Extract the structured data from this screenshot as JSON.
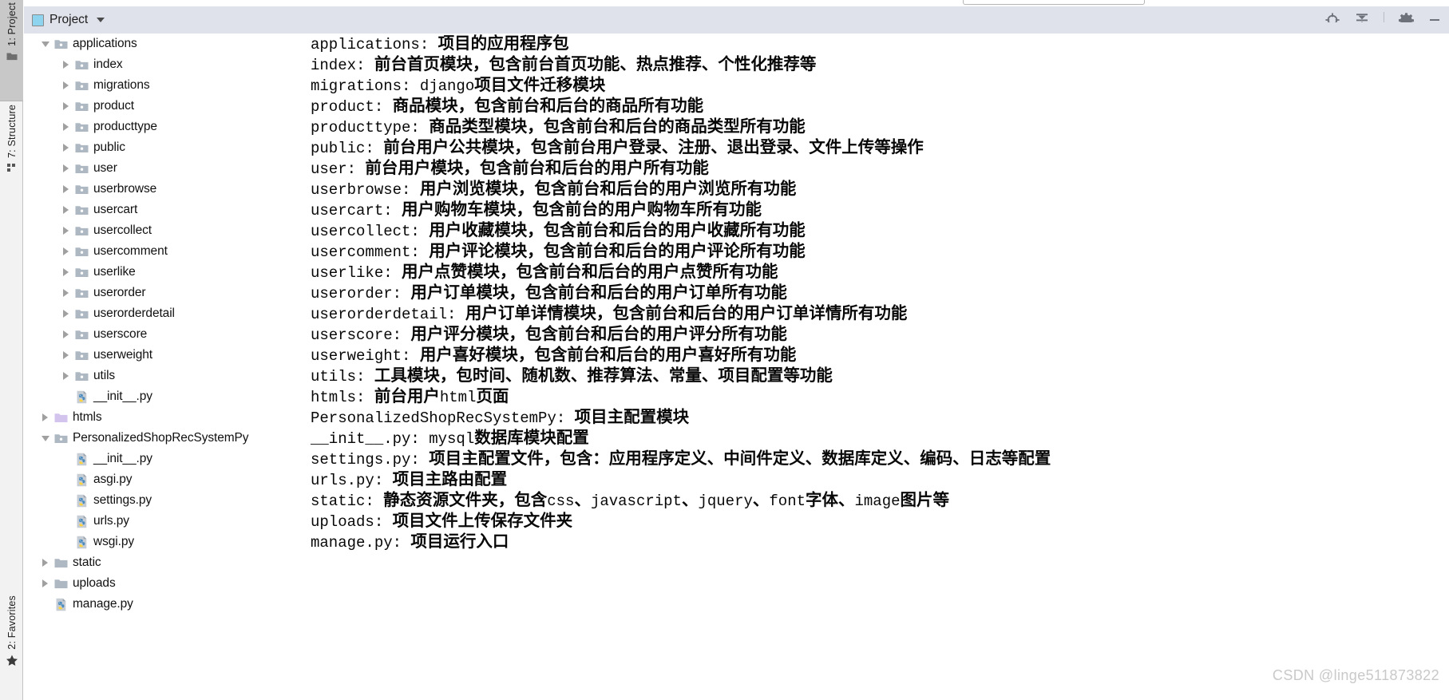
{
  "window": {
    "panel_title": "Project",
    "watermark": "CSDN @linge511873822"
  },
  "left_strip": {
    "tabs": [
      {
        "label": "1: Project",
        "icon": "project-folder-icon",
        "active": true
      },
      {
        "label": "7: Structure",
        "icon": "structure-blocks-icon",
        "active": false
      },
      {
        "label": "2: Favorites",
        "icon": "star-icon",
        "active": false
      }
    ]
  },
  "header_actions": [
    {
      "name": "locate-target-icon",
      "label": "Select Opened File"
    },
    {
      "name": "collapse-all-icon",
      "label": "Collapse All"
    },
    {
      "name": "gear-icon",
      "label": "Settings"
    },
    {
      "name": "hide-icon",
      "label": "Hide"
    }
  ],
  "tree": {
    "items": [
      {
        "label": "applications",
        "icon": "folder-module-icon",
        "arrow": "down",
        "indent": 1
      },
      {
        "label": "index",
        "icon": "folder-module-icon",
        "arrow": "right",
        "indent": 2
      },
      {
        "label": "migrations",
        "icon": "folder-module-icon",
        "arrow": "right",
        "indent": 2
      },
      {
        "label": "product",
        "icon": "folder-module-icon",
        "arrow": "right",
        "indent": 2
      },
      {
        "label": "producttype",
        "icon": "folder-module-icon",
        "arrow": "right",
        "indent": 2
      },
      {
        "label": "public",
        "icon": "folder-module-icon",
        "arrow": "right",
        "indent": 2
      },
      {
        "label": "user",
        "icon": "folder-module-icon",
        "arrow": "right",
        "indent": 2
      },
      {
        "label": "userbrowse",
        "icon": "folder-module-icon",
        "arrow": "right",
        "indent": 2
      },
      {
        "label": "usercart",
        "icon": "folder-module-icon",
        "arrow": "right",
        "indent": 2
      },
      {
        "label": "usercollect",
        "icon": "folder-module-icon",
        "arrow": "right",
        "indent": 2
      },
      {
        "label": "usercomment",
        "icon": "folder-module-icon",
        "arrow": "right",
        "indent": 2
      },
      {
        "label": "userlike",
        "icon": "folder-module-icon",
        "arrow": "right",
        "indent": 2
      },
      {
        "label": "userorder",
        "icon": "folder-module-icon",
        "arrow": "right",
        "indent": 2
      },
      {
        "label": "userorderdetail",
        "icon": "folder-module-icon",
        "arrow": "right",
        "indent": 2
      },
      {
        "label": "userscore",
        "icon": "folder-module-icon",
        "arrow": "right",
        "indent": 2
      },
      {
        "label": "userweight",
        "icon": "folder-module-icon",
        "arrow": "right",
        "indent": 2
      },
      {
        "label": "utils",
        "icon": "folder-module-icon",
        "arrow": "right",
        "indent": 2
      },
      {
        "label": "__init__.py",
        "icon": "python-file-icon",
        "arrow": "none",
        "indent": 2
      },
      {
        "label": "htmls",
        "icon": "folder-template-icon",
        "arrow": "right",
        "indent": 1
      },
      {
        "label": "PersonalizedShopRecSystemPy",
        "icon": "folder-module-icon",
        "arrow": "down",
        "indent": 1
      },
      {
        "label": "__init__.py",
        "icon": "python-file-icon",
        "arrow": "none",
        "indent": 2
      },
      {
        "label": "asgi.py",
        "icon": "python-file-icon",
        "arrow": "none",
        "indent": 2
      },
      {
        "label": "settings.py",
        "icon": "python-file-icon",
        "arrow": "none",
        "indent": 2
      },
      {
        "label": "urls.py",
        "icon": "python-file-icon",
        "arrow": "none",
        "indent": 2
      },
      {
        "label": "wsgi.py",
        "icon": "python-file-icon",
        "arrow": "none",
        "indent": 2
      },
      {
        "label": "static",
        "icon": "folder-plain-icon",
        "arrow": "right",
        "indent": 1
      },
      {
        "label": "uploads",
        "icon": "folder-plain-icon",
        "arrow": "right",
        "indent": 1
      },
      {
        "label": "manage.py",
        "icon": "python-file-icon",
        "arrow": "none",
        "indent": 1
      }
    ]
  },
  "document": {
    "lines": [
      {
        "code": "applications: ",
        "cn": "项目的应用程序包"
      },
      {
        "code": "index: ",
        "cn": "前台首页模块，包含前台首页功能、热点推荐、个性化推荐等"
      },
      {
        "code": "migrations: django",
        "cn": "项目文件迁移模块"
      },
      {
        "code": "product: ",
        "cn": "商品模块，包含前台和后台的商品所有功能"
      },
      {
        "code": "producttype: ",
        "cn": "商品类型模块，包含前台和后台的商品类型所有功能"
      },
      {
        "code": "public: ",
        "cn": "前台用户公共模块，包含前台用户登录、注册、退出登录、文件上传等操作"
      },
      {
        "code": "user: ",
        "cn": "前台用户模块，包含前台和后台的用户所有功能"
      },
      {
        "code": "userbrowse: ",
        "cn": "用户浏览模块，包含前台和后台的用户浏览所有功能"
      },
      {
        "code": "usercart: ",
        "cn": "用户购物车模块，包含前台的用户购物车所有功能"
      },
      {
        "code": "usercollect: ",
        "cn": "用户收藏模块，包含前台和后台的用户收藏所有功能"
      },
      {
        "code": "usercomment: ",
        "cn": "用户评论模块，包含前台和后台的用户评论所有功能"
      },
      {
        "code": "userlike: ",
        "cn": "用户点赞模块，包含前台和后台的用户点赞所有功能"
      },
      {
        "code": "userorder: ",
        "cn": "用户订单模块，包含前台和后台的用户订单所有功能"
      },
      {
        "code": "userorderdetail: ",
        "cn": "用户订单详情模块，包含前台和后台的用户订单详情所有功能"
      },
      {
        "code": "userscore: ",
        "cn": "用户评分模块，包含前台和后台的用户评分所有功能"
      },
      {
        "code": "userweight: ",
        "cn": "用户喜好模块，包含前台和后台的用户喜好所有功能"
      },
      {
        "code": "utils: ",
        "cn": "工具模块，包时间、随机数、推荐算法、常量、项目配置等功能"
      },
      {
        "code": "htmls: ",
        "cn": "前台用户",
        "code2": "html",
        "cn2": "页面"
      },
      {
        "code": "PersonalizedShopRecSystemPy: ",
        "cn": "项目主配置模块"
      },
      {
        "code": "__init__.py: mysql",
        "cn": "数据库模块配置"
      },
      {
        "code": "settings.py: ",
        "cn": "项目主配置文件，包含：应用程序定义、中间件定义、数据库定义、编码、日志等配置"
      },
      {
        "code": "urls.py: ",
        "cn": "项目主路由配置"
      },
      {
        "code": "static: ",
        "cn": "静态资源文件夹，包含",
        "code2": "css",
        "cn2": "、",
        "code3": "javascript",
        "cn3": "、",
        "code4": "jquery",
        "cn4": "、",
        "code5": "font",
        "cn5": "字体、",
        "code6": "image",
        "cn6": "图片等"
      },
      {
        "code": "uploads: ",
        "cn": "项目文件上传保存文件夹"
      },
      {
        "code": "manage.py: ",
        "cn": "项目运行入口"
      }
    ]
  },
  "colors": {
    "header_bg": "#dfe2ea",
    "strip_bg": "#f2f2f2",
    "strip_active": "#c8c8c8",
    "folder": "#aeb8c2",
    "folder_template": "#d3c4ee",
    "text": "#080808",
    "watermark": "#c9c9c9"
  }
}
